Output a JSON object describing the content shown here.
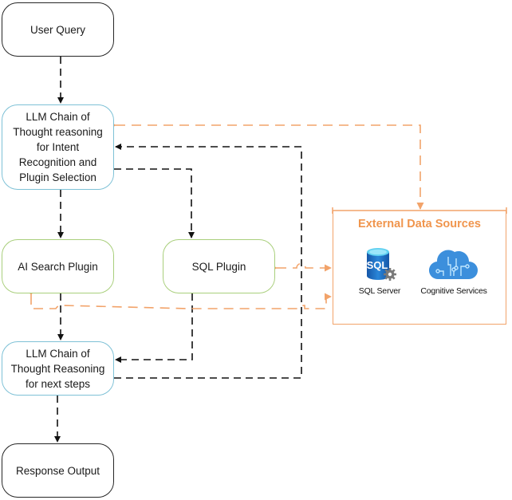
{
  "diagram": {
    "nodes": {
      "user_query": {
        "lines": [
          "User Query"
        ]
      },
      "llm_intent": {
        "lines": [
          "LLM Chain of",
          "Thought reasoning",
          "for Intent",
          "Recognition and",
          "Plugin Selection"
        ]
      },
      "ai_search_plugin": {
        "lines": [
          "AI Search Plugin"
        ]
      },
      "sql_plugin": {
        "lines": [
          "SQL Plugin"
        ]
      },
      "llm_next": {
        "lines": [
          "LLM Chain of",
          "Thought Reasoning",
          "for next steps"
        ]
      },
      "response_output": {
        "lines": [
          "Response Output"
        ]
      }
    },
    "external_sources": {
      "title": "External Data Sources",
      "items": [
        {
          "label": "SQL Server",
          "icon": "sql-server-icon",
          "icon_text": "SQL"
        },
        {
          "label": "Cognitive Services",
          "icon": "cognitive-services-icon"
        }
      ]
    },
    "edges": [
      {
        "from": "User Query",
        "to": "LLM Chain of Thought reasoning for Intent Recognition and Plugin Selection",
        "style": "dashed",
        "color": "black"
      },
      {
        "from": "LLM Chain of Thought reasoning for Intent Recognition and Plugin Selection",
        "to": "AI Search Plugin",
        "style": "dashed",
        "color": "black"
      },
      {
        "from": "LLM Chain of Thought reasoning for Intent Recognition and Plugin Selection",
        "to": "SQL Plugin",
        "style": "dashed",
        "color": "black"
      },
      {
        "from": "AI Search Plugin",
        "to": "LLM Chain of Thought Reasoning for next steps",
        "style": "dashed",
        "color": "black"
      },
      {
        "from": "SQL Plugin",
        "to": "LLM Chain of Thought Reasoning for next steps",
        "style": "dashed",
        "color": "black"
      },
      {
        "from": "LLM Chain of Thought Reasoning for next steps",
        "to": "LLM Chain of Thought reasoning for Intent Recognition and Plugin Selection",
        "style": "dashed",
        "color": "black"
      },
      {
        "from": "LLM Chain of Thought Reasoning for next steps",
        "to": "Response Output",
        "style": "dashed",
        "color": "black"
      },
      {
        "from": "External Data Sources",
        "to": "LLM Chain of Thought reasoning for Intent Recognition and Plugin Selection",
        "style": "dashed",
        "color": "orange",
        "bidirectional": true
      },
      {
        "from": "External Data Sources",
        "to": "SQL Plugin",
        "style": "dashed",
        "color": "orange",
        "bidirectional": true
      },
      {
        "from": "AI Search Plugin",
        "to": "External Data Sources",
        "style": "dashed",
        "color": "orange",
        "bidirectional": true
      }
    ],
    "colors": {
      "flow_black": "#1a1a1a",
      "external_orange": "#f2a36a",
      "terminal_border": "#262626",
      "llm_border": "#7ec1d6",
      "plugin_border": "#a9cf7c",
      "sql_icon_blue": "#1f6fc4",
      "cloud_blue": "#3c8fdc"
    }
  }
}
